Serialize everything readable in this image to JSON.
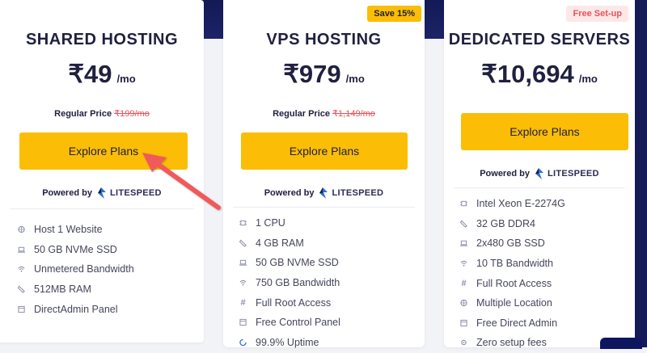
{
  "plans": {
    "shared": {
      "title": "SHARED HOSTING",
      "price": "₹49",
      "per": "/mo",
      "regular_label": "Regular Price",
      "regular_price": "₹199/mo",
      "button": "Explore Plans",
      "powered_by": "Powered by",
      "brand": "LITESPEED",
      "features": [
        "Host 1 Website",
        "50 GB NVMe SSD",
        "Unmetered Bandwidth",
        "512MB RAM",
        "DirectAdmin Panel"
      ]
    },
    "vps": {
      "badge": "Save 15%",
      "title": "VPS HOSTING",
      "price": "₹979",
      "per": "/mo",
      "regular_label": "Regular Price",
      "regular_price": "₹1,149/mo",
      "button": "Explore Plans",
      "powered_by": "Powered by",
      "brand": "LITESPEED",
      "features": [
        "1 CPU",
        "4 GB RAM",
        "50 GB NVMe SSD",
        "750 GB Bandwidth",
        "Full Root Access",
        "Free Control Panel",
        "99.9% Uptime"
      ]
    },
    "dedicated": {
      "badge": "Free Set-up",
      "title": "DEDICATED SERVERS",
      "price": "₹10,694",
      "per": "/mo",
      "button": "Explore Plans",
      "powered_by": "Powered by",
      "brand": "LITESPEED",
      "features": [
        "Intel Xeon E-2274G",
        "32 GB DDR4",
        "2x480 GB SSD",
        "10 TB Bandwidth",
        "Full Root Access",
        "Multiple Location",
        "Free Direct Admin",
        "Zero setup fees"
      ]
    }
  },
  "colors": {
    "accent": "#fbbd05",
    "strike": "#e8525b",
    "navy": "#141a55",
    "arrow": "#f05a5a"
  }
}
